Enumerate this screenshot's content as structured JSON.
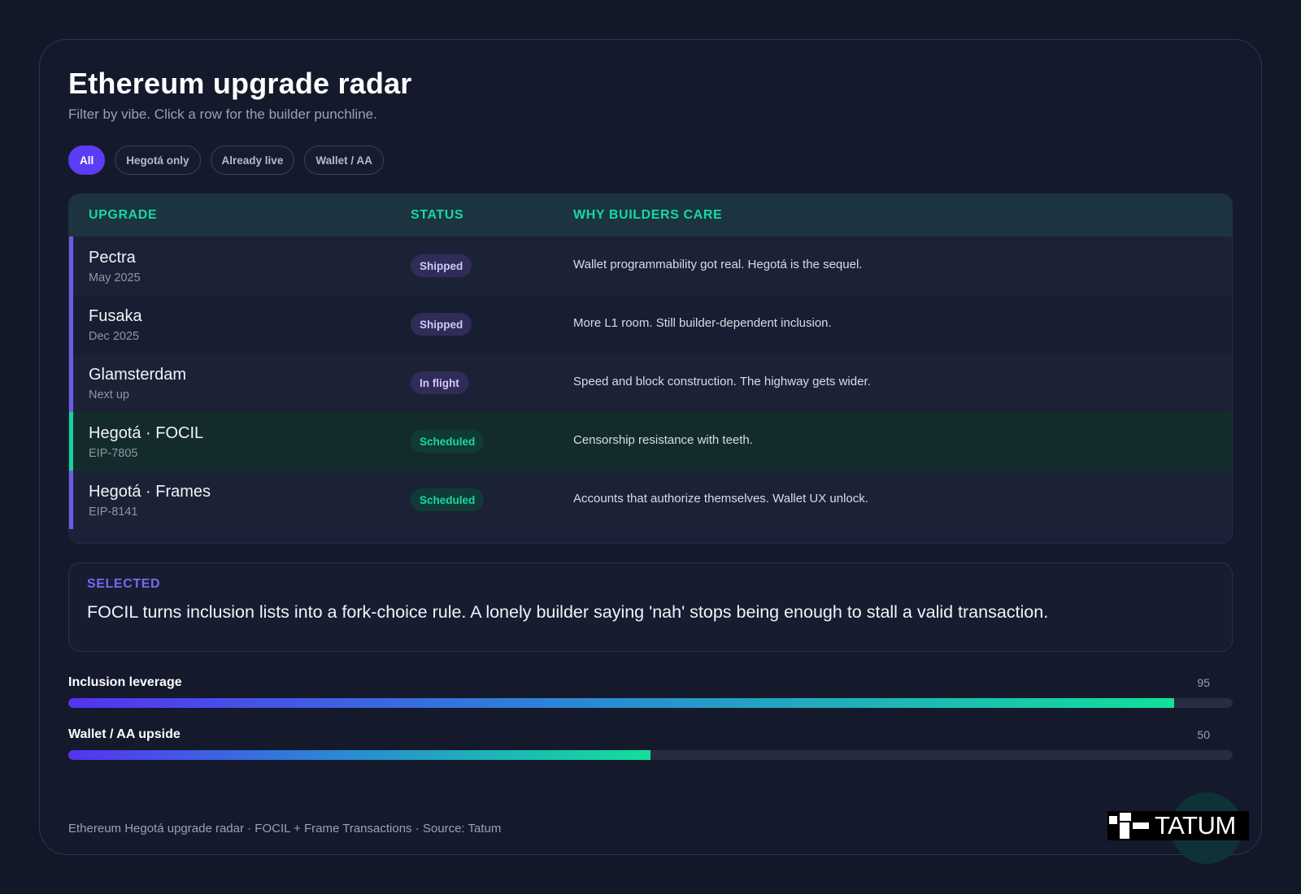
{
  "header": {
    "title": "Ethereum upgrade radar",
    "subtitle": "Filter by vibe. Click a row for the builder punchline."
  },
  "filters": [
    {
      "label": "All",
      "active": true
    },
    {
      "label": "Hegotá only",
      "active": false
    },
    {
      "label": "Already live",
      "active": false
    },
    {
      "label": "Wallet / AA",
      "active": false
    }
  ],
  "table": {
    "columns": [
      "UPGRADE",
      "STATUS",
      "WHY BUILDERS CARE"
    ],
    "rows": [
      {
        "name": "Pectra",
        "sub": "May 2025",
        "status": "Shipped",
        "why": "Wallet programmability got real. Hegotá is the sequel."
      },
      {
        "name": "Fusaka",
        "sub": "Dec 2025",
        "status": "Shipped",
        "why": "More L1 room. Still builder-dependent inclusion."
      },
      {
        "name": "Glamsterdam",
        "sub": "Next up",
        "status": "In flight",
        "why": "Speed and block construction. The highway gets wider."
      },
      {
        "name": "Hegotá · FOCIL",
        "sub": "EIP-7805",
        "status": "Scheduled",
        "why": "Censorship resistance with teeth."
      },
      {
        "name": "Hegotá · Frames",
        "sub": "EIP-8141",
        "status": "Scheduled",
        "why": "Accounts that authorize themselves. Wallet UX unlock."
      }
    ],
    "selected_index": 3
  },
  "selected": {
    "label": "SELECTED",
    "text": "FOCIL turns inclusion lists into a fork-choice rule. A lonely builder saying 'nah' stops being enough to stall a valid transaction."
  },
  "metrics": [
    {
      "label": "Inclusion leverage",
      "value": 95,
      "display": "95"
    },
    {
      "label": "Wallet / AA upside",
      "value": 50,
      "display": "50"
    }
  ],
  "footer": {
    "text": "Ethereum Hegotá upgrade radar · FOCIL + Frame Transactions · Source: Tatum",
    "logo_text": "TATUM"
  },
  "colors": {
    "accent": "#5b3df5",
    "teal": "#16d9a0",
    "background": "#131829"
  }
}
